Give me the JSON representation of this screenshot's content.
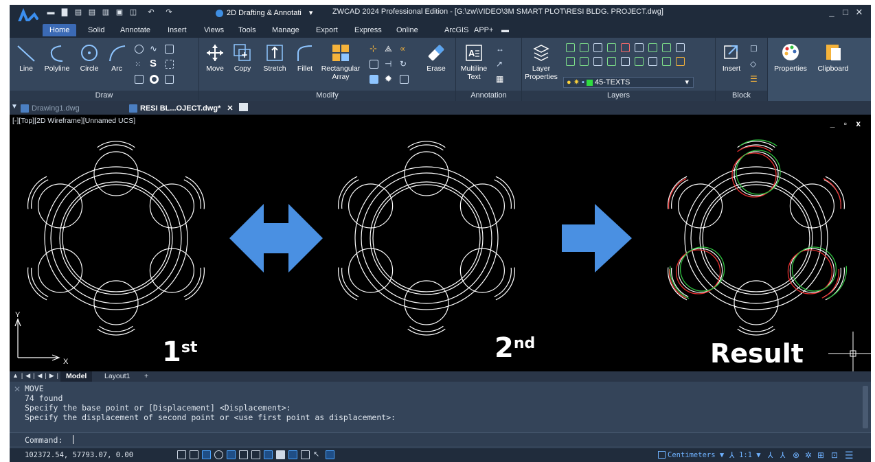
{
  "titlebar": {
    "workspace": "2D Drafting & Annotati",
    "title": "ZWCAD 2024 Professional Edition - [G:\\zw\\VIDEO\\3M SMART PLOT\\RESI BLDG. PROJECT.dwg]"
  },
  "menu_tabs": [
    "Home",
    "Solid",
    "Annotate",
    "Insert",
    "Views",
    "Tools",
    "Manage",
    "Export",
    "Express",
    "Online",
    "ArcGIS",
    "APP+"
  ],
  "ribbon": {
    "draw": {
      "title": "Draw",
      "line": "Line",
      "polyline": "Polyline",
      "circle": "Circle",
      "arc": "Arc"
    },
    "modify": {
      "title": "Modify",
      "move": "Move",
      "copy": "Copy",
      "stretch": "Stretch",
      "fillet": "Fillet",
      "rect_array_1": "Rectangular",
      "rect_array_2": "Array",
      "erase": "Erase"
    },
    "annotation": {
      "title": "Annotation",
      "mtext_1": "Multiline",
      "mtext_2": "Text"
    },
    "layers": {
      "title": "Layers",
      "props_1": "Layer",
      "props_2": "Properties",
      "current_layer": "45-TEXTS"
    },
    "block": {
      "title": "Block",
      "insert": "Insert"
    },
    "properties": "Properties",
    "clipboard": "Clipboard"
  },
  "doc_tabs": {
    "tab1": "Drawing1.dwg",
    "tab2": "RESI BL...OJECT.dwg*"
  },
  "viewport": {
    "label": "[-][Top][2D Wireframe][Unnamed UCS]",
    "axis_y": "Y",
    "axis_x": "X",
    "label_first": "1",
    "label_first_sup": "st",
    "label_second": "2",
    "label_second_sup": "nd",
    "label_result": "Result"
  },
  "layout_tabs": {
    "model": "Model",
    "layout1": "Layout1",
    "add": "+"
  },
  "command": {
    "history": [
      "MOVE",
      "74 found",
      "Specify the base point or [Displacement] <Displacement>:",
      "Specify the displacement of second point or <use first point as displacement>:"
    ],
    "prompt": "Command:"
  },
  "status": {
    "coords": "102372.54, 57793.07, 0.00",
    "units": "Centimeters",
    "scale": "1:1"
  },
  "colors": {
    "accent": "#3b6ab5",
    "arrow": "#4a90e2",
    "overlay_red": "#e53030",
    "overlay_green": "#2fbf3f"
  }
}
